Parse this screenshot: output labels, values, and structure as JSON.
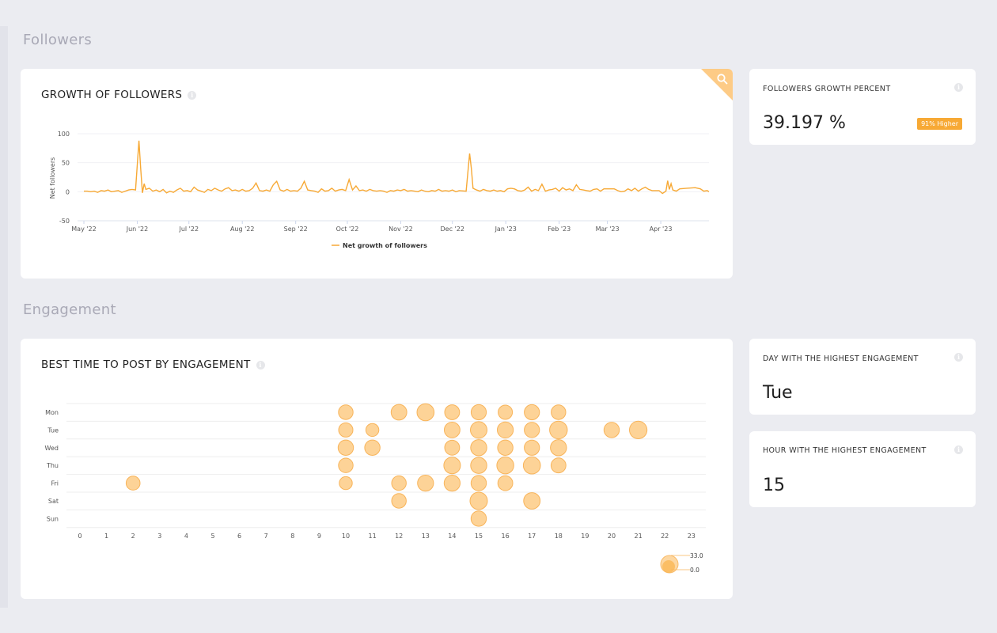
{
  "sections": {
    "followers": "Followers",
    "engagement": "Engagement"
  },
  "growth_card": {
    "title": "GROWTH OF FOLLOWERS",
    "zoom_icon": "search-icon",
    "info_icon": "info-icon"
  },
  "followers_growth_kpi": {
    "title": "FOLLOWERS GROWTH PERCENT",
    "value": "39.197 %",
    "badge": "91% Higher",
    "badge_color": "#f7a935"
  },
  "best_time_card": {
    "title": "BEST TIME TO POST BY ENGAGEMENT",
    "info_icon": "info-icon"
  },
  "day_kpi": {
    "title": "DAY WITH THE HIGHEST ENGAGEMENT",
    "value": "Tue"
  },
  "hour_kpi": {
    "title": "HOUR WITH THE HIGHEST ENGAGEMENT",
    "value": "15"
  },
  "colors": {
    "accent": "#f7a935",
    "bubble_fill": "#fdd397",
    "bubble_stroke": "#f8b45a",
    "grid": "#eeeeee"
  },
  "chart_data": [
    {
      "type": "line",
      "title": "GROWTH OF FOLLOWERS",
      "xlabel": "",
      "ylabel": "Net followers",
      "ylim": [
        -50,
        100
      ],
      "yticks": [
        "100",
        "50",
        "0",
        "-50"
      ],
      "ytick_values": [
        100,
        50,
        0,
        -50
      ],
      "xticks": [
        "May '22",
        "Jun '22",
        "Jul '22",
        "Aug '22",
        "Sep '22",
        "Oct '22",
        "Nov '22",
        "Dec '22",
        "Jan '23",
        "Feb '23",
        "Mar '23",
        "Apr '23"
      ],
      "x_range_days": [
        0,
        363
      ],
      "xtick_days": [
        0,
        31,
        61,
        92,
        123,
        153,
        184,
        214,
        245,
        276,
        304,
        335
      ],
      "legend": [
        "Net growth of followers"
      ],
      "legend_position": "bottom-center",
      "grid": true,
      "series": [
        {
          "name": "Net growth of followers",
          "points": [
            [
              0,
              1
            ],
            [
              2,
              1
            ],
            [
              4,
              0
            ],
            [
              6,
              1
            ],
            [
              8,
              -1
            ],
            [
              10,
              2
            ],
            [
              12,
              1
            ],
            [
              14,
              3
            ],
            [
              16,
              0
            ],
            [
              18,
              1
            ],
            [
              20,
              2
            ],
            [
              22,
              -1
            ],
            [
              24,
              1
            ],
            [
              26,
              3
            ],
            [
              28,
              4
            ],
            [
              30,
              3
            ],
            [
              32,
              88
            ],
            [
              33,
              40
            ],
            [
              34,
              -2
            ],
            [
              35,
              14
            ],
            [
              36,
              4
            ],
            [
              38,
              6
            ],
            [
              40,
              1
            ],
            [
              42,
              3
            ],
            [
              44,
              0
            ],
            [
              46,
              4
            ],
            [
              48,
              -2
            ],
            [
              50,
              1
            ],
            [
              52,
              -1
            ],
            [
              54,
              3
            ],
            [
              56,
              6
            ],
            [
              58,
              1
            ],
            [
              60,
              2
            ],
            [
              62,
              0
            ],
            [
              64,
              8
            ],
            [
              66,
              3
            ],
            [
              68,
              1
            ],
            [
              70,
              -1
            ],
            [
              72,
              4
            ],
            [
              74,
              2
            ],
            [
              76,
              6
            ],
            [
              78,
              3
            ],
            [
              80,
              1
            ],
            [
              82,
              5
            ],
            [
              84,
              7
            ],
            [
              86,
              2
            ],
            [
              88,
              3
            ],
            [
              90,
              1
            ],
            [
              92,
              4
            ],
            [
              94,
              1
            ],
            [
              96,
              2
            ],
            [
              98,
              6
            ],
            [
              100,
              15
            ],
            [
              102,
              2
            ],
            [
              104,
              1
            ],
            [
              106,
              3
            ],
            [
              108,
              1
            ],
            [
              110,
              12
            ],
            [
              112,
              18
            ],
            [
              114,
              3
            ],
            [
              116,
              1
            ],
            [
              118,
              4
            ],
            [
              120,
              1
            ],
            [
              122,
              2
            ],
            [
              124,
              1
            ],
            [
              126,
              6
            ],
            [
              128,
              18
            ],
            [
              130,
              3
            ],
            [
              132,
              2
            ],
            [
              134,
              1
            ],
            [
              136,
              -1
            ],
            [
              138,
              5
            ],
            [
              140,
              1
            ],
            [
              142,
              2
            ],
            [
              144,
              6
            ],
            [
              146,
              1
            ],
            [
              148,
              3
            ],
            [
              150,
              4
            ],
            [
              152,
              2
            ],
            [
              154,
              21
            ],
            [
              156,
              3
            ],
            [
              158,
              10
            ],
            [
              160,
              2
            ],
            [
              162,
              3
            ],
            [
              164,
              1
            ],
            [
              166,
              4
            ],
            [
              168,
              2
            ],
            [
              170,
              1
            ],
            [
              172,
              2
            ],
            [
              174,
              1
            ],
            [
              176,
              -1
            ],
            [
              178,
              2
            ],
            [
              180,
              1
            ],
            [
              182,
              3
            ],
            [
              184,
              2
            ],
            [
              186,
              4
            ],
            [
              188,
              1
            ],
            [
              190,
              2
            ],
            [
              192,
              1
            ],
            [
              194,
              0
            ],
            [
              196,
              3
            ],
            [
              198,
              1
            ],
            [
              200,
              0
            ],
            [
              202,
              2
            ],
            [
              204,
              1
            ],
            [
              206,
              4
            ],
            [
              208,
              1
            ],
            [
              210,
              2
            ],
            [
              212,
              1
            ],
            [
              214,
              3
            ],
            [
              216,
              0
            ],
            [
              218,
              2
            ],
            [
              222,
              1
            ],
            [
              224,
              66
            ],
            [
              225,
              40
            ],
            [
              226,
              6
            ],
            [
              228,
              3
            ],
            [
              230,
              1
            ],
            [
              232,
              4
            ],
            [
              234,
              2
            ],
            [
              236,
              1
            ],
            [
              238,
              3
            ],
            [
              240,
              1
            ],
            [
              242,
              2
            ],
            [
              244,
              0
            ],
            [
              246,
              5
            ],
            [
              248,
              6
            ],
            [
              250,
              5
            ],
            [
              252,
              2
            ],
            [
              254,
              1
            ],
            [
              256,
              3
            ],
            [
              258,
              8
            ],
            [
              260,
              1
            ],
            [
              262,
              4
            ],
            [
              264,
              2
            ],
            [
              266,
              13
            ],
            [
              268,
              1
            ],
            [
              270,
              3
            ],
            [
              272,
              4
            ],
            [
              274,
              6
            ],
            [
              276,
              1
            ],
            [
              278,
              7
            ],
            [
              280,
              3
            ],
            [
              282,
              5
            ],
            [
              284,
              2
            ],
            [
              286,
              12
            ],
            [
              288,
              4
            ],
            [
              290,
              3
            ],
            [
              292,
              2
            ],
            [
              294,
              1
            ],
            [
              296,
              4
            ],
            [
              298,
              5
            ],
            [
              300,
              1
            ],
            [
              302,
              5
            ],
            [
              304,
              5
            ],
            [
              306,
              5
            ],
            [
              308,
              5
            ],
            [
              310,
              2
            ],
            [
              312,
              0
            ],
            [
              314,
              1
            ],
            [
              316,
              5
            ],
            [
              318,
              2
            ],
            [
              320,
              6
            ],
            [
              322,
              1
            ],
            [
              324,
              5
            ],
            [
              326,
              8
            ],
            [
              328,
              4
            ],
            [
              330,
              2
            ],
            [
              332,
              2
            ],
            [
              334,
              2
            ],
            [
              336,
              -3
            ],
            [
              338,
              1
            ],
            [
              339,
              19
            ],
            [
              340,
              4
            ],
            [
              341,
              14
            ],
            [
              342,
              3
            ],
            [
              344,
              1
            ],
            [
              346,
              5
            ],
            [
              350,
              6
            ],
            [
              355,
              7
            ],
            [
              358,
              5
            ],
            [
              360,
              1
            ],
            [
              362,
              2
            ],
            [
              363,
              0
            ]
          ]
        }
      ]
    },
    {
      "type": "scatter",
      "subtype": "bubble",
      "title": "BEST TIME TO POST BY ENGAGEMENT",
      "categories_y": [
        "Mon",
        "Tue",
        "Wed",
        "Thu",
        "Fri",
        "Sat",
        "Sun"
      ],
      "x": [
        0,
        1,
        2,
        3,
        4,
        5,
        6,
        7,
        8,
        9,
        10,
        11,
        12,
        13,
        14,
        15,
        16,
        17,
        18,
        19,
        20,
        21,
        22,
        23
      ],
      "size_legend": [
        "33.0",
        "0.0"
      ],
      "size_range": [
        0,
        33
      ],
      "grid": true,
      "points": [
        {
          "day": "Mon",
          "hour": 10,
          "value": 14
        },
        {
          "day": "Mon",
          "hour": 12,
          "value": 18
        },
        {
          "day": "Mon",
          "hour": 13,
          "value": 24
        },
        {
          "day": "Mon",
          "hour": 14,
          "value": 15
        },
        {
          "day": "Mon",
          "hour": 15,
          "value": 16
        },
        {
          "day": "Mon",
          "hour": 16,
          "value": 13
        },
        {
          "day": "Mon",
          "hour": 17,
          "value": 16
        },
        {
          "day": "Mon",
          "hour": 18,
          "value": 14
        },
        {
          "day": "Tue",
          "hour": 10,
          "value": 13
        },
        {
          "day": "Tue",
          "hour": 11,
          "value": 9
        },
        {
          "day": "Tue",
          "hour": 14,
          "value": 18
        },
        {
          "day": "Tue",
          "hour": 15,
          "value": 22
        },
        {
          "day": "Tue",
          "hour": 16,
          "value": 19
        },
        {
          "day": "Tue",
          "hour": 17,
          "value": 16
        },
        {
          "day": "Tue",
          "hour": 18,
          "value": 27
        },
        {
          "day": "Tue",
          "hour": 20,
          "value": 17
        },
        {
          "day": "Tue",
          "hour": 21,
          "value": 26
        },
        {
          "day": "Wed",
          "hour": 10,
          "value": 17
        },
        {
          "day": "Wed",
          "hour": 11,
          "value": 17
        },
        {
          "day": "Wed",
          "hour": 14,
          "value": 15
        },
        {
          "day": "Wed",
          "hour": 15,
          "value": 20
        },
        {
          "day": "Wed",
          "hour": 16,
          "value": 17
        },
        {
          "day": "Wed",
          "hour": 17,
          "value": 16
        },
        {
          "day": "Wed",
          "hour": 18,
          "value": 20
        },
        {
          "day": "Thu",
          "hour": 10,
          "value": 14
        },
        {
          "day": "Thu",
          "hour": 14,
          "value": 22
        },
        {
          "day": "Thu",
          "hour": 15,
          "value": 20
        },
        {
          "day": "Thu",
          "hour": 16,
          "value": 23
        },
        {
          "day": "Thu",
          "hour": 17,
          "value": 24
        },
        {
          "day": "Thu",
          "hour": 18,
          "value": 15
        },
        {
          "day": "Fri",
          "hour": 2,
          "value": 12
        },
        {
          "day": "Fri",
          "hour": 10,
          "value": 9
        },
        {
          "day": "Fri",
          "hour": 12,
          "value": 14
        },
        {
          "day": "Fri",
          "hour": 13,
          "value": 19
        },
        {
          "day": "Fri",
          "hour": 14,
          "value": 19
        },
        {
          "day": "Fri",
          "hour": 15,
          "value": 17
        },
        {
          "day": "Fri",
          "hour": 16,
          "value": 15
        },
        {
          "day": "Sat",
          "hour": 12,
          "value": 14
        },
        {
          "day": "Sat",
          "hour": 15,
          "value": 25
        },
        {
          "day": "Sat",
          "hour": 17,
          "value": 21
        },
        {
          "day": "Sun",
          "hour": 15,
          "value": 17
        }
      ]
    }
  ]
}
